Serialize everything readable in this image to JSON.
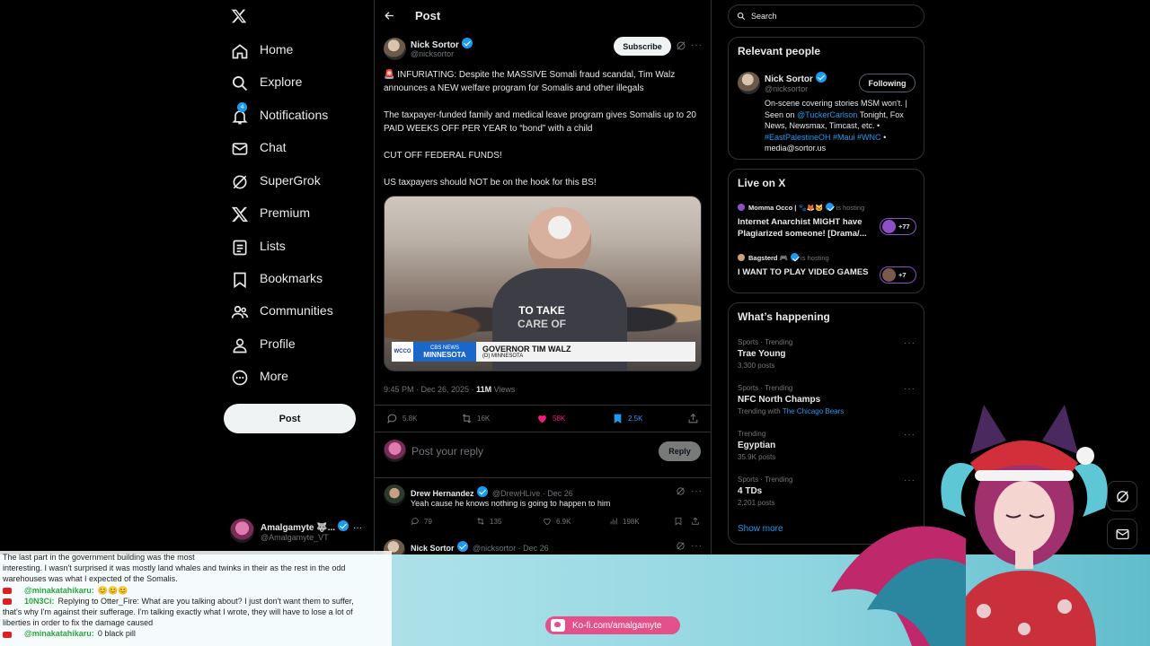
{
  "nav": {
    "items": [
      {
        "label": "Home",
        "icon": "home-icon"
      },
      {
        "label": "Explore",
        "icon": "search-icon"
      },
      {
        "label": "Notifications",
        "icon": "bell-icon",
        "badge": "4"
      },
      {
        "label": "Chat",
        "icon": "mail-icon"
      },
      {
        "label": "SuperGrok",
        "icon": "grok-icon"
      },
      {
        "label": "Premium",
        "icon": "x-logo-icon"
      },
      {
        "label": "Lists",
        "icon": "list-icon"
      },
      {
        "label": "Bookmarks",
        "icon": "bookmark-icon"
      },
      {
        "label": "Communities",
        "icon": "people-icon"
      },
      {
        "label": "Profile",
        "icon": "person-icon"
      },
      {
        "label": "More",
        "icon": "more-circle-icon"
      }
    ],
    "post_button": "Post",
    "account": {
      "name": "Amalgamyte 🐺...",
      "handle": "@Amalgamyte_VT"
    }
  },
  "header": {
    "title": "Post"
  },
  "post": {
    "author": "Nick Sortor",
    "handle": "@nicksortor",
    "subscribe": "Subscribe",
    "para1": "🚨 INFURIATING: Despite the MASSIVE Somali fraud scandal, Tim Walz announces a NEW welfare program for Somalis and other illegals",
    "para2": "The taxpayer-funded family and medical leave program gives Somalis up to 20 PAID WEEKS OFF PER YEAR to “bond” with a  child",
    "para3": "CUT OFF FEDERAL FUNDS!",
    "para4": "US taxpayers should NOT be on the hook for this BS!",
    "video": {
      "caption_line1": "TO TAKE",
      "caption_line2": "CARE OF",
      "station": "WCCO",
      "network_line1": "CBS NEWS",
      "network_line2": "MINNESOTA",
      "lower_third_name": "GOVERNOR TIM WALZ",
      "lower_third_sub": "(D) MINNESOTA"
    },
    "timestamp": "9:45 PM · Dec 26, 2025 · ",
    "views_count": "11M",
    "views_label": " Views",
    "replies": "5.8K",
    "reposts": "16K",
    "likes": "58K",
    "bookmarks": "2.5K",
    "reply_placeholder": "Post your reply",
    "reply_button": "Reply"
  },
  "replies": [
    {
      "name": "Drew Hernandez",
      "handle": "@DrewHLive · Dec 26",
      "text": "Yeah cause he knows nothing is going to happen to him",
      "replies": "79",
      "reposts": "135",
      "likes": "6.9K",
      "views": "198K"
    },
    {
      "name": "Nick Sortor",
      "handle": "@nicksortor · Dec 26"
    }
  ],
  "search": {
    "placeholder": "Search"
  },
  "relevant": {
    "title": "Relevant people",
    "name": "Nick Sortor",
    "handle": "@nicksortor",
    "follow_label": "Following",
    "bio_a": "On-scene covering stories MSM won't. | Seen on ",
    "bio_link1": "@TuckerCarlson",
    "bio_b": " Tonight, Fox News, Newsmax, Timcast, etc. • ",
    "bio_tags": "#EastPalestineOH #Maui #WNC",
    "bio_c": " • media@sortor.us"
  },
  "live": {
    "title": "Live on X",
    "items": [
      {
        "host": "Momma Occo | 🐾🦊🐱",
        "status": "is hosting",
        "title": "Internet Anarchist MIGHT have Plagiarized someone! [Drama/...",
        "count": "+77"
      },
      {
        "host": "Bagsterd 🎮",
        "status": "is hosting",
        "title": "I WANT TO PLAY VIDEO GAMES",
        "count": "+7"
      }
    ]
  },
  "happening": {
    "title": "What’s happening",
    "items": [
      {
        "meta": "Sports · Trending",
        "topic": "Trae Young",
        "count": "3,300 posts"
      },
      {
        "meta": "Sports · Trending",
        "topic": "NFC North Champs",
        "count_prefix": "Trending with ",
        "count_link": "The Chicago Bears"
      },
      {
        "meta": "Trending",
        "topic": "Egyptian",
        "count": "35.9K posts"
      },
      {
        "meta": "Sports · Trending",
        "topic": "4 TDs",
        "count": "2,201 posts"
      }
    ],
    "show_more": "Show more"
  },
  "overlay": {
    "chat": [
      {
        "user": "",
        "text": "The last part in the government building was the most"
      },
      {
        "user": "",
        "text": "interesting. I wasn't surprised it was mostly land whales and twinks in their as the rest in the odd"
      },
      {
        "user": "",
        "text": "warehouses was what I expected of the Somalis."
      },
      {
        "user": "@minakatahikaru:",
        "text": "😊😊😊"
      },
      {
        "user": "10N3Ci:",
        "text": "Replying to Otter_Fire: What are you talking about? I just don't want them to suffer,"
      },
      {
        "user": "",
        "text": "that's why I'm against their sufferage. I'm talking exactly what I wrote, they will have to lose a lot of"
      },
      {
        "user": "",
        "text": "liberties in order to fix the damage caused"
      },
      {
        "user": "@minakatahikaru:",
        "text": "0 black pill"
      }
    ],
    "kofi": "Ko-fi.com/amalgamyte"
  },
  "colors": {
    "accent": "#1d9bf0",
    "like": "#f91880",
    "bg": "#000000",
    "border": "#2f3336",
    "muted": "#71767b"
  }
}
